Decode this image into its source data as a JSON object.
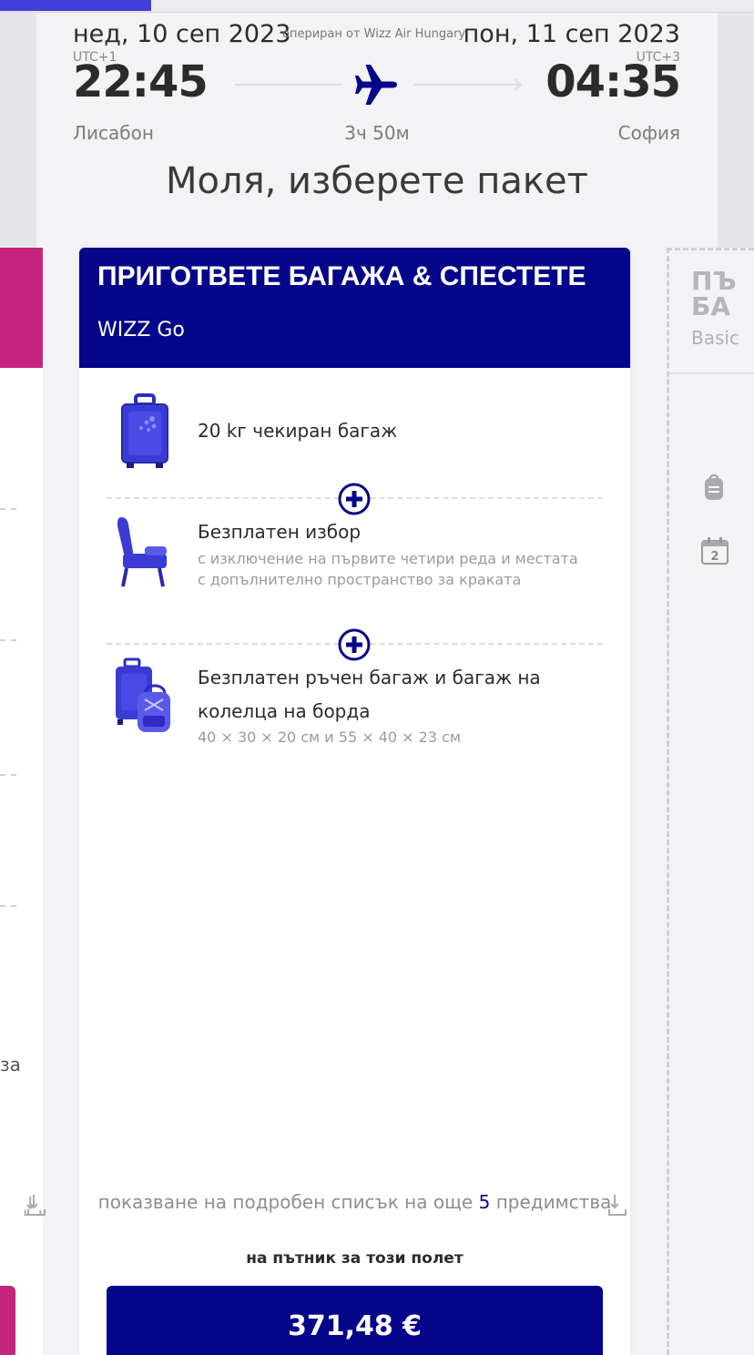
{
  "colors": {
    "brand_navy": "#06068a",
    "brand_magenta": "#c6247e",
    "icon_blue": "#3b3bd4",
    "progress": "#3f3fd8"
  },
  "flight": {
    "departure_date": "нед, 10 сеп 2023",
    "arrival_date": "пон, 11 сеп 2023",
    "operator": "опериран от Wizz Air Hungary",
    "departure_utc": "UTC+1",
    "arrival_utc": "UTC+3",
    "departure_time": "22:45",
    "arrival_time": "04:35",
    "departure_city": "Лисабон",
    "arrival_city": "София",
    "duration": "3ч 50м",
    "plane_icon": "plane-icon"
  },
  "page": {
    "title": "Моля, изберете пакет"
  },
  "featured_bundle": {
    "title": "ПРИГОТВЕТЕ БАГАЖА & СПЕСТЕТЕ",
    "subtitle": "WIZZ Go",
    "features": [
      {
        "icon": "suitcase-icon",
        "title": "20 kг чекиран багаж",
        "description": ""
      },
      {
        "icon": "seat-icon",
        "title": "Безплатен избор",
        "description": "с изключение на първите четири реда и местата с допълнително пространство за краката"
      },
      {
        "icon": "cabin-bags-icon",
        "title_line1": "Безплатен ръчен багаж и багаж на",
        "title_line2": "колелца на борда",
        "description": "40 × 30 × 20 см и 55 × 40 × 23 см"
      }
    ],
    "more_benefits_prefix": "показване на подробен списък на още",
    "more_benefits_count": "5",
    "more_benefits_suffix": "предимства",
    "price_note": "на пътник за този полет",
    "price": "371,48 €"
  },
  "left_bundle": {
    "partial_text": "за"
  },
  "right_bundle": {
    "title_partial": "ПЪ\nБА",
    "subtitle_partial": "Basic"
  }
}
